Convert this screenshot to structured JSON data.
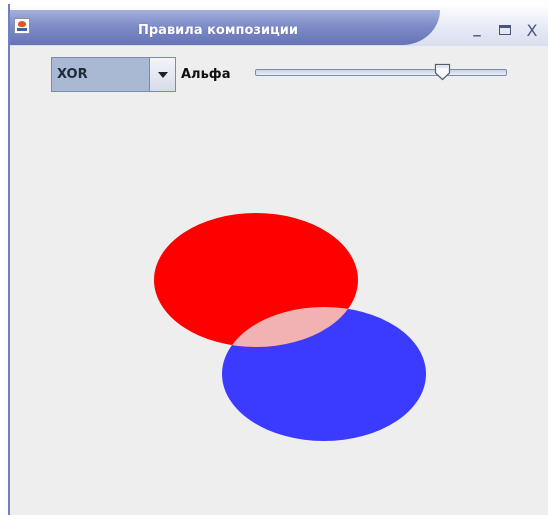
{
  "window": {
    "title": "Правила композиции",
    "controls": {
      "minimize": "_",
      "close": "X"
    }
  },
  "toolbar": {
    "rule_select": {
      "value": "XOR"
    },
    "alpha_label": "Альфа",
    "alpha_slider": {
      "value": 0.76
    }
  },
  "canvas": {
    "shapes": [
      {
        "name": "red-ellipse",
        "color": "#ff0000"
      },
      {
        "name": "blue-ellipse",
        "color": "#3b3bff"
      },
      {
        "name": "overlap",
        "color": "#f0b2b2"
      }
    ],
    "background": "#eeeeee"
  }
}
